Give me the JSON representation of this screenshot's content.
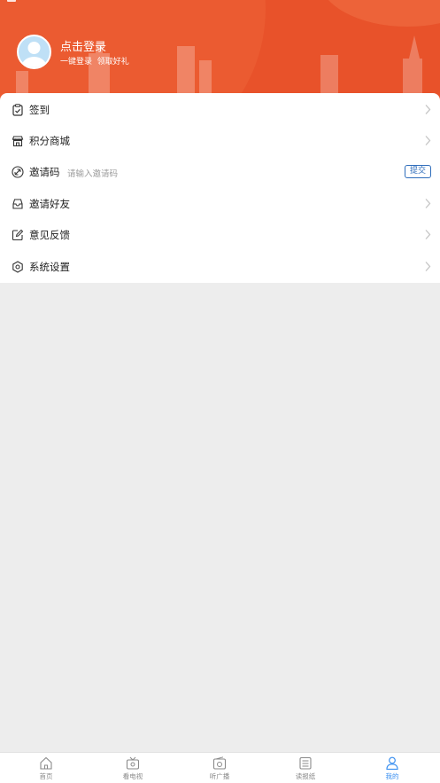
{
  "user": {
    "login_title": "点击登录",
    "login_subtitle": "一键登录  领取好礼"
  },
  "menu": {
    "items": [
      {
        "label": "签到",
        "icon": "clipboard-check-icon"
      },
      {
        "label": "积分商城",
        "icon": "shop-icon"
      },
      {
        "label": "邀请码",
        "icon": "link-circle-icon",
        "placeholder": "请输入邀请码",
        "submit_label": "提交"
      },
      {
        "label": "邀请好友",
        "icon": "inbox-icon"
      },
      {
        "label": "意见反馈",
        "icon": "edit-icon"
      },
      {
        "label": "系统设置",
        "icon": "gear-icon"
      }
    ]
  },
  "tabs": [
    {
      "label": "首页",
      "icon": "home-icon",
      "active": false
    },
    {
      "label": "看电视",
      "icon": "tv-icon",
      "active": false
    },
    {
      "label": "听广播",
      "icon": "radio-icon",
      "active": false
    },
    {
      "label": "读报纸",
      "icon": "newspaper-icon",
      "active": false
    },
    {
      "label": "我的",
      "icon": "user-icon",
      "active": true
    }
  ],
  "colors": {
    "header_bg": "#e8522a",
    "accent_blue": "#3a8ff0",
    "submit_blue": "#2f6dbb",
    "page_bg": "#ededed"
  }
}
